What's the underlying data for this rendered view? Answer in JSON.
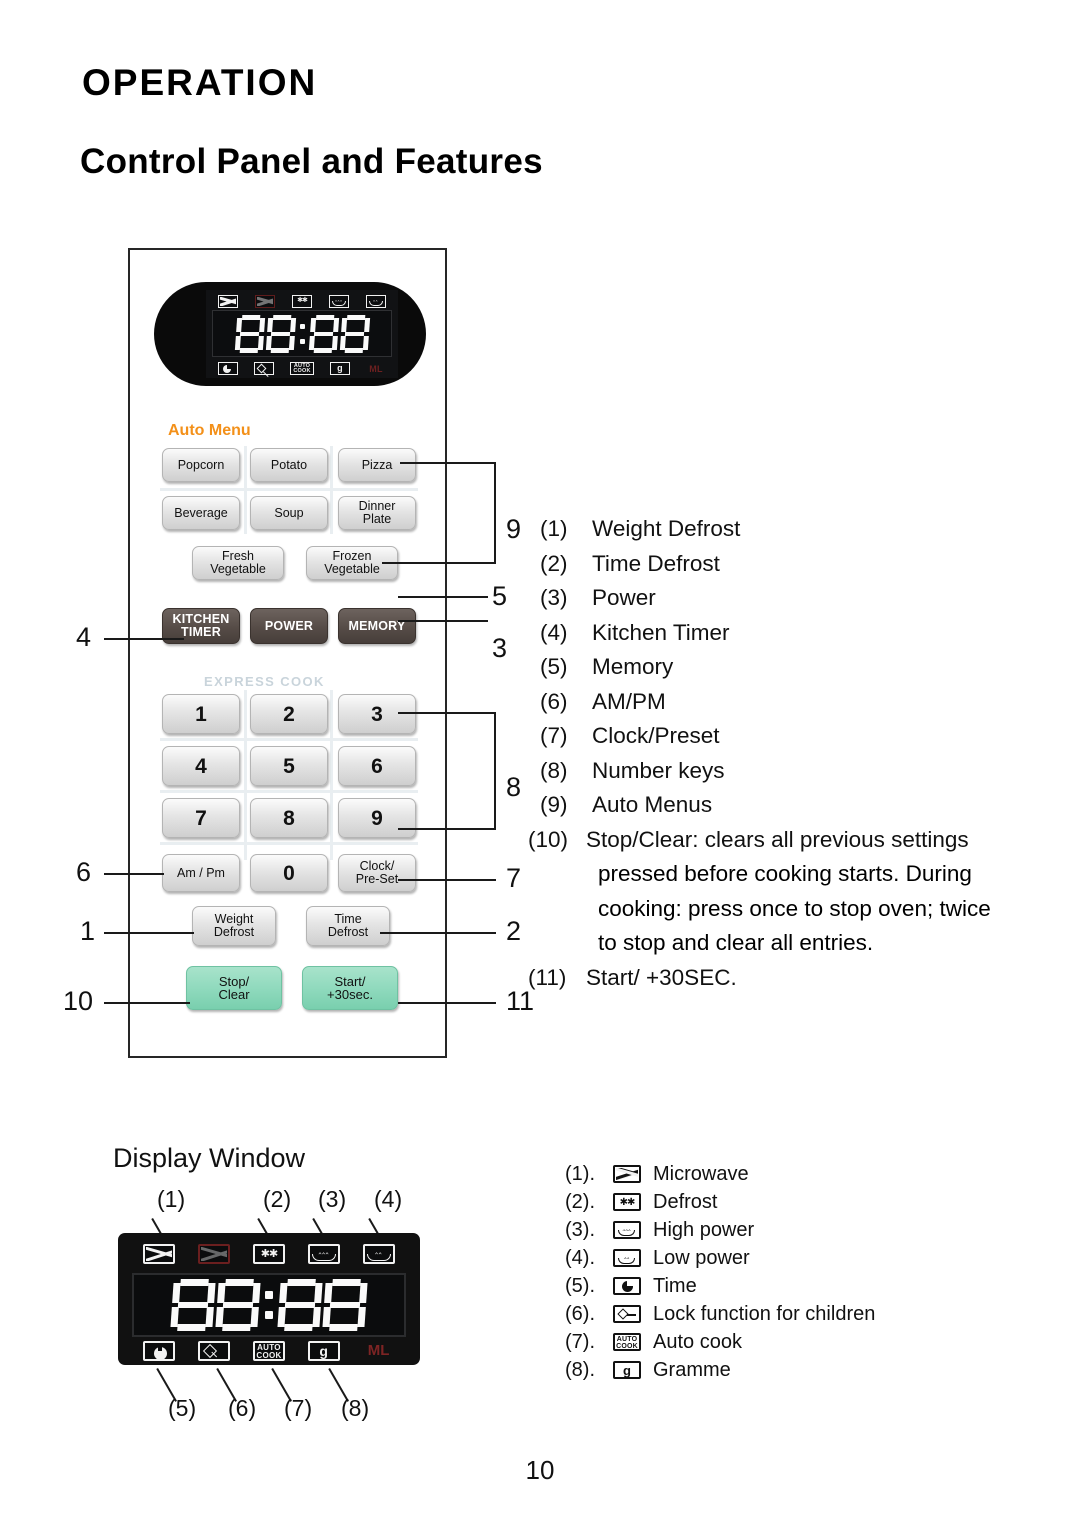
{
  "page": {
    "heading": "OPERATION",
    "subheading": "Control Panel and Features",
    "page_number": "10"
  },
  "control_panel": {
    "auto_menu_label": "Auto Menu",
    "express_cook_label": "EXPRESS COOK",
    "display_value": "88:88",
    "auto_menu_buttons": [
      {
        "label": "Popcorn"
      },
      {
        "label": "Potato"
      },
      {
        "label": "Pizza"
      },
      {
        "label": "Beverage"
      },
      {
        "label": "Soup"
      },
      {
        "label": "Dinner\nPlate"
      },
      {
        "label": "Fresh\nVegetable"
      },
      {
        "label": "Frozen\nVegetable"
      }
    ],
    "function_buttons": [
      {
        "label": "KITCHEN\nTIMER"
      },
      {
        "label": "POWER"
      },
      {
        "label": "MEMORY"
      }
    ],
    "number_buttons": [
      "1",
      "2",
      "3",
      "4",
      "5",
      "6",
      "7",
      "8",
      "9"
    ],
    "bottom_buttons": [
      {
        "label": "Am / Pm"
      },
      {
        "label": "0"
      },
      {
        "label": "Clock/\nPre-Set"
      },
      {
        "label": "Weight\nDefrost"
      },
      {
        "label": "Time\nDefrost"
      }
    ],
    "action_buttons": [
      {
        "label": "Stop/\nClear"
      },
      {
        "label": "Start/\n+30sec."
      }
    ],
    "callouts_left": [
      "4",
      "6",
      "1",
      "10"
    ],
    "callouts_right": [
      "9",
      "5",
      "3",
      "8",
      "7",
      "2",
      "11"
    ]
  },
  "feature_list": [
    {
      "num": "(1)",
      "text": "Weight Defrost"
    },
    {
      "num": "(2)",
      "text": "Time Defrost"
    },
    {
      "num": "(3)",
      "text": "Power"
    },
    {
      "num": "(4)",
      "text": "Kitchen Timer"
    },
    {
      "num": "(5)",
      "text": "Memory"
    },
    {
      "num": "(6)",
      "text": "AM/PM"
    },
    {
      "num": "(7)",
      "text": "Clock/Preset"
    },
    {
      "num": "(8)",
      "text": "Number keys"
    },
    {
      "num": "(9)",
      "text": "Auto Menus"
    },
    {
      "num": "(10)",
      "text": "Stop/Clear: clears all previous settings"
    },
    {
      "num": "(11)",
      "text": "Start/ +30SEC."
    }
  ],
  "feature_list_continuation": [
    "pressed before cooking starts. During",
    "cooking: press once to stop oven; twice",
    "to stop and clear all entries."
  ],
  "display_window": {
    "title": "Display  Window",
    "value": "88:88",
    "top_callouts": [
      "(1)",
      "(2)",
      "(3)",
      "(4)"
    ],
    "bottom_callouts": [
      "(5)",
      "(6)",
      "(7)",
      "(8)"
    ],
    "indicator_labels": {
      "auto_cook": "AUTO\nCOOK",
      "gramme": "g",
      "ml": "ML"
    }
  },
  "icon_legend": [
    {
      "num": "(1).",
      "icon": "microwave-icon",
      "label": "Microwave"
    },
    {
      "num": "(2).",
      "icon": "defrost-icon",
      "label": "Defrost"
    },
    {
      "num": "(3).",
      "icon": "high-power-icon",
      "label": "High power"
    },
    {
      "num": "(4).",
      "icon": "low-power-icon",
      "label": "Low power"
    },
    {
      "num": "(5).",
      "icon": "time-icon",
      "label": "Time"
    },
    {
      "num": "(6).",
      "icon": "child-lock-icon",
      "label": "Lock function for children"
    },
    {
      "num": "(7).",
      "icon": "auto-cook-icon",
      "label": "Auto cook"
    },
    {
      "num": "(8).",
      "icon": "gramme-icon",
      "label": "Gramme"
    }
  ],
  "colors": {
    "auto_menu_accent": "#f39019",
    "express_cook": "#c9d4db",
    "action_button": "#8ed9bc",
    "function_button": "#564c47"
  }
}
